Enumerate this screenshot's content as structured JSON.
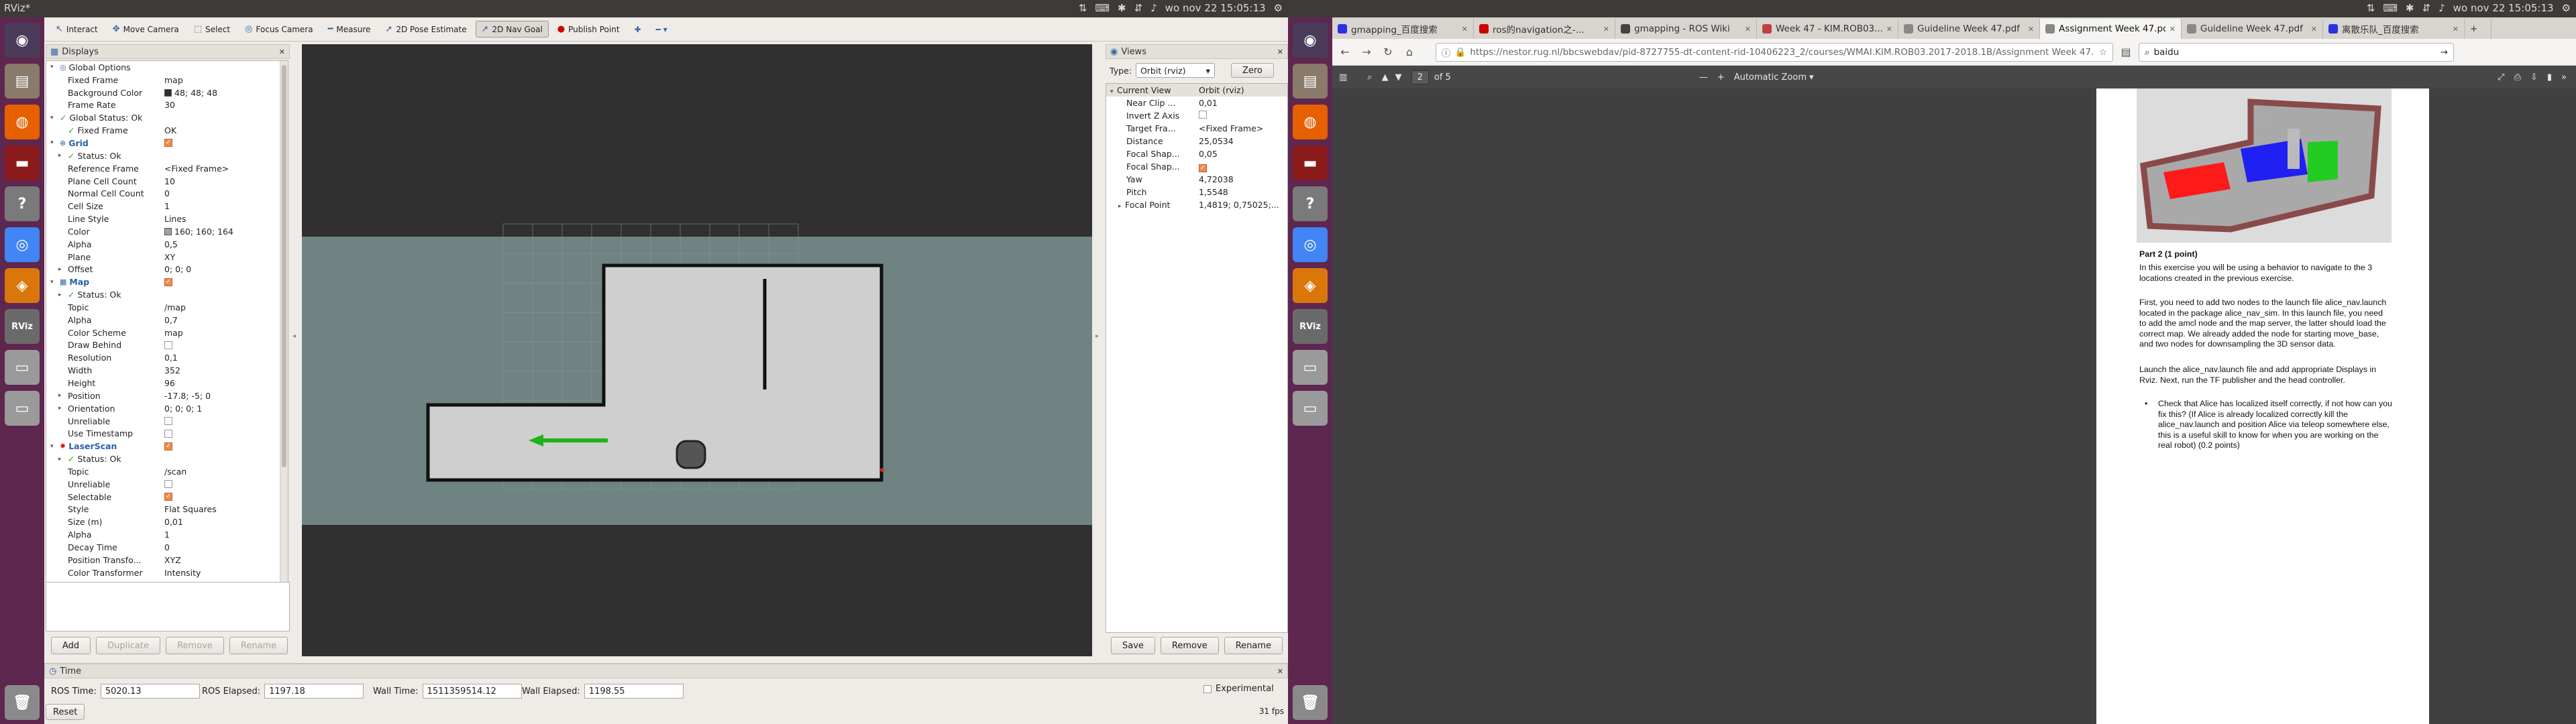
{
  "topbar_left": {
    "title": "RViz*",
    "clock": "wo nov 22 15:05:13"
  },
  "topbar_right": {
    "title": "",
    "clock": "wo nov 22 15:05:13"
  },
  "launcher": {
    "items": [
      {
        "name": "dash-icon",
        "color": "#4b3b5b",
        "glyph": "◉"
      },
      {
        "name": "files-icon",
        "color": "#8a7a6a",
        "glyph": "▤"
      },
      {
        "name": "firefox-icon",
        "color": "#e66000",
        "glyph": "◍"
      },
      {
        "name": "terminal-icon",
        "color": "#8b1a1a",
        "glyph": "▬"
      },
      {
        "name": "help-icon",
        "color": "#7a7a7a",
        "glyph": "?"
      },
      {
        "name": "chrome-icon",
        "color": "#4285f4",
        "glyph": "◎"
      },
      {
        "name": "box-icon",
        "color": "#d9770b",
        "glyph": "◈"
      },
      {
        "name": "rviz-icon",
        "color": "#6a6a6a",
        "glyph": "RViz"
      },
      {
        "name": "drive-icon",
        "color": "#9a9a9a",
        "glyph": "▭"
      },
      {
        "name": "drive2-icon",
        "color": "#9a9a9a",
        "glyph": "▭"
      }
    ],
    "trash": {
      "name": "trash-icon",
      "color": "#8a8a8a",
      "glyph": "🗑"
    }
  },
  "toolbar": {
    "items": [
      {
        "label": "Interact",
        "glyph": "↖",
        "active": false
      },
      {
        "label": "Move Camera",
        "glyph": "✥",
        "active": false
      },
      {
        "label": "Select",
        "glyph": "⬚",
        "active": false
      },
      {
        "label": "Focus Camera",
        "glyph": "◎",
        "active": false
      },
      {
        "label": "Measure",
        "glyph": "━",
        "active": false
      },
      {
        "label": "2D Pose Estimate",
        "glyph": "➚",
        "active": false
      },
      {
        "label": "2D Nav Goal",
        "glyph": "➚",
        "active": true
      },
      {
        "label": "Publish Point",
        "glyph": "●",
        "active": false
      }
    ],
    "extra": [
      "✚",
      "━ ▾"
    ]
  },
  "displays": {
    "title": "Displays",
    "rows": [
      {
        "indent": 0,
        "arrow": "▾",
        "icon": "◎",
        "label": "Global Options",
        "value": ""
      },
      {
        "indent": 1,
        "label": "Fixed Frame",
        "value": "map"
      },
      {
        "indent": 1,
        "label": "Background Color",
        "value": "48; 48; 48",
        "swatch": "#303030"
      },
      {
        "indent": 1,
        "label": "Frame Rate",
        "value": "30"
      },
      {
        "indent": 0,
        "arrow": "▾",
        "status": "✓",
        "label": "Global Status: Ok",
        "value": ""
      },
      {
        "indent": 1,
        "status": "✓",
        "label": "Fixed Frame",
        "value": "OK"
      },
      {
        "indent": 0,
        "arrow": "▾",
        "icon": "⊕",
        "label": "Grid",
        "value": "",
        "check": true,
        "blue": true
      },
      {
        "indent": 1,
        "arrow": "▸",
        "status": "✓",
        "label": "Status: Ok",
        "value": ""
      },
      {
        "indent": 1,
        "label": "Reference Frame",
        "value": "<Fixed Frame>"
      },
      {
        "indent": 1,
        "label": "Plane Cell Count",
        "value": "10"
      },
      {
        "indent": 1,
        "label": "Normal Cell Count",
        "value": "0"
      },
      {
        "indent": 1,
        "label": "Cell Size",
        "value": "1"
      },
      {
        "indent": 1,
        "label": "Line Style",
        "value": "Lines"
      },
      {
        "indent": 1,
        "label": "Color",
        "value": "160; 160; 164",
        "swatch": "#a0a0a4"
      },
      {
        "indent": 1,
        "label": "Alpha",
        "value": "0,5"
      },
      {
        "indent": 1,
        "label": "Plane",
        "value": "XY"
      },
      {
        "indent": 1,
        "arrow": "▸",
        "label": "Offset",
        "value": "0; 0; 0"
      },
      {
        "indent": 0,
        "arrow": "▾",
        "icon": "▦",
        "label": "Map",
        "value": "",
        "check": true,
        "blue": true
      },
      {
        "indent": 1,
        "arrow": "▸",
        "status": "✓",
        "label": "Status: Ok",
        "value": ""
      },
      {
        "indent": 1,
        "label": "Topic",
        "value": "/map"
      },
      {
        "indent": 1,
        "label": "Alpha",
        "value": "0,7"
      },
      {
        "indent": 1,
        "label": "Color Scheme",
        "value": "map"
      },
      {
        "indent": 1,
        "label": "Draw Behind",
        "value": "",
        "check": false
      },
      {
        "indent": 1,
        "label": "Resolution",
        "value": "0,1"
      },
      {
        "indent": 1,
        "label": "Width",
        "value": "352"
      },
      {
        "indent": 1,
        "label": "Height",
        "value": "96"
      },
      {
        "indent": 1,
        "arrow": "▸",
        "label": "Position",
        "value": "-17.8; -5; 0"
      },
      {
        "indent": 1,
        "arrow": "▸",
        "label": "Orientation",
        "value": "0; 0; 0; 1"
      },
      {
        "indent": 1,
        "label": "Unreliable",
        "value": "",
        "check": false
      },
      {
        "indent": 1,
        "label": "Use Timestamp",
        "value": "",
        "check": false
      },
      {
        "indent": 0,
        "arrow": "▾",
        "icon": "✸",
        "label": "LaserScan",
        "value": "",
        "check": true,
        "blue": true,
        "red": true
      },
      {
        "indent": 1,
        "arrow": "▸",
        "status": "✓",
        "label": "Status: Ok",
        "value": ""
      },
      {
        "indent": 1,
        "label": "Topic",
        "value": "/scan"
      },
      {
        "indent": 1,
        "label": "Unreliable",
        "value": "",
        "check": false
      },
      {
        "indent": 1,
        "label": "Selectable",
        "value": "",
        "check": true
      },
      {
        "indent": 1,
        "label": "Style",
        "value": "Flat Squares"
      },
      {
        "indent": 1,
        "label": "Size (m)",
        "value": "0,01"
      },
      {
        "indent": 1,
        "label": "Alpha",
        "value": "1"
      },
      {
        "indent": 1,
        "label": "Decay Time",
        "value": "0"
      },
      {
        "indent": 1,
        "label": "Position Transfo...",
        "value": "XYZ"
      },
      {
        "indent": 1,
        "label": "Color Transformer",
        "value": "Intensity"
      }
    ],
    "buttons": [
      "Add",
      "Duplicate",
      "Remove",
      "Rename"
    ]
  },
  "views": {
    "title": "Views",
    "type_label": "Type:",
    "type_value": "Orbit (rviz)",
    "zero_label": "Zero",
    "header": {
      "label": "Current View",
      "value": "Orbit (rviz)"
    },
    "rows": [
      {
        "label": "Near Clip ...",
        "value": "0,01"
      },
      {
        "label": "Invert Z Axis",
        "value": "",
        "check": false
      },
      {
        "label": "Target Fra...",
        "value": "<Fixed Frame>"
      },
      {
        "label": "Distance",
        "value": "25,0534"
      },
      {
        "label": "Focal Shap...",
        "value": "0,05"
      },
      {
        "label": "Focal Shap...",
        "value": "",
        "check": true
      },
      {
        "label": "Yaw",
        "value": "4,72038"
      },
      {
        "label": "Pitch",
        "value": "1,5548"
      },
      {
        "label": "Focal Point",
        "value": "1,4819; 0,75025;...",
        "arrow": "▸"
      }
    ],
    "buttons": [
      "Save",
      "Remove",
      "Rename"
    ]
  },
  "time": {
    "title": "Time",
    "ros_time_label": "ROS Time:",
    "ros_time": "5020.13",
    "ros_elapsed_label": "ROS Elapsed:",
    "ros_elapsed": "1197.18",
    "wall_time_label": "Wall Time:",
    "wall_time": "1511359514.12",
    "wall_elapsed_label": "Wall Elapsed:",
    "wall_elapsed": "1198.55",
    "experimental_label": "Experimental",
    "reset_label": "Reset",
    "fps": "31 fps"
  },
  "browser": {
    "tabs": [
      {
        "title": "gmapping_百度搜索",
        "fav": "#2932e1",
        "active": false
      },
      {
        "title": "ros的navigation之-...",
        "fav": "#c00",
        "active": false
      },
      {
        "title": "gmapping - ROS Wiki",
        "fav": "#444",
        "active": false
      },
      {
        "title": "Week 47 - KIM.ROB03...",
        "fav": "#c04040",
        "active": false
      },
      {
        "title": "Guideline Week 47.pdf",
        "fav": "#888",
        "active": false
      },
      {
        "title": "Assignment Week 47.pdf",
        "fav": "#888",
        "active": true
      },
      {
        "title": "Guideline Week 47.pdf",
        "fav": "#888",
        "active": false
      },
      {
        "title": "离散乐队_百度搜索",
        "fav": "#2932e1",
        "active": false
      }
    ],
    "url": "https://nestor.rug.nl/bbcswebdav/pid-8727755-dt-content-rid-10406223_2/courses/WMAI.KIM.ROB03.2017-2018.1B/Assignment Week 47...",
    "search": "baidu",
    "pdf": {
      "page_value": "2",
      "page_of": "of 5",
      "zoom": "Automatic Zoom"
    }
  },
  "document": {
    "heading": "Part 2 (1 point)",
    "p1": "In this exercise you will be using a behavior to navigate to the 3 locations created in the previous exercise.",
    "p2": "First, you need to add two nodes to the launch file alice_nav.launch located in the package alice_nav_sim. In this launch file, you need to add the amcl node and the map server, the latter should load the correct map. We already added the node for starting move_base, and two nodes for downsampling the 3D sensor data.",
    "p3": "Launch the alice_nav.launch file and add appropriate Displays in Rviz. Next, run the TF publisher and the head controller.",
    "bullet": "Check that Alice has localized itself correctly, if not how can you fix this? (If Alice is already localized correctly kill the alice_nav.launch and position Alice via teleop somewhere else, this is a useful skill to know for when you are working on the real robot)  (0.2 points)"
  }
}
